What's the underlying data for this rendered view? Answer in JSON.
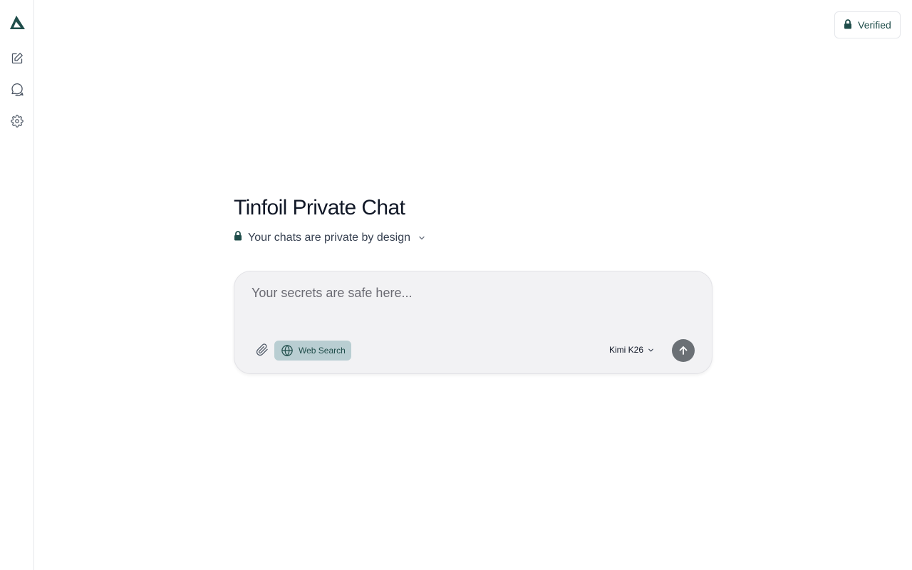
{
  "sidebar": {
    "logo_icon": "tinfoil-logo-icon",
    "items": [
      {
        "name": "new-chat",
        "icon": "edit-square-icon"
      },
      {
        "name": "chats",
        "icon": "chat-bubbles-icon"
      },
      {
        "name": "settings",
        "icon": "gear-icon"
      }
    ]
  },
  "header": {
    "verified_label": "Verified",
    "verified_icon": "lock-icon"
  },
  "main": {
    "title": "Tinfoil Private Chat",
    "privacy_text": "Your chats are private by design",
    "privacy_icon": "lock-icon"
  },
  "composer": {
    "placeholder": "Your secrets are safe here...",
    "value": "",
    "web_search_label": "Web Search",
    "web_search_active": true,
    "model_label": "Kimi K26"
  },
  "colors": {
    "brand": "#1f4d4a",
    "composer_bg": "#f2f2f4",
    "web_search_bg": "#b9ced2",
    "send_bg": "#6b7075"
  }
}
